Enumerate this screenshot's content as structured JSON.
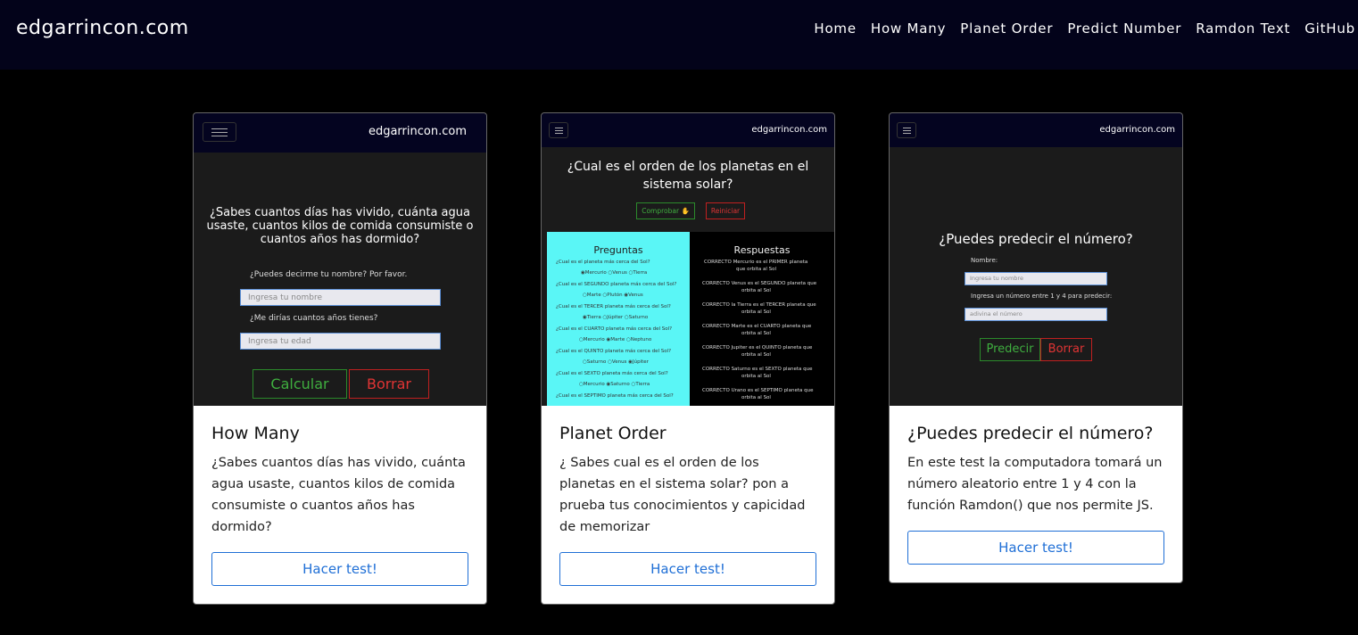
{
  "nav": {
    "brand": "edgarrincon.com",
    "links": [
      "Home",
      "How Many",
      "Planet Order",
      "Predict Number",
      "Ramdon Text",
      "GitHub"
    ]
  },
  "cards": [
    {
      "title": "How Many",
      "text": "¿Sabes cuantos días has vivido, cuánta agua usaste, cuantos kilos de comida consumiste o cuantos años has dormido?",
      "button": "Hacer test!",
      "preview": {
        "brand": "edgarrincon.com",
        "heading": "¿Sabes cuantos días has vivido, cuánta agua usaste, cuantos kilos de comida consumiste o cuantos años has dormido?",
        "q1": "¿Puedes decirme tu nombre? Por favor.",
        "p1": "Ingresa tu nombre",
        "q2": "¿Me dirías cuantos años tienes?",
        "p2": "Ingresa tu edad",
        "btn_calc": "Calcular",
        "btn_clear": "Borrar"
      }
    },
    {
      "title": "Planet Order",
      "text": "¿ Sabes cual es el orden de los planetas en el sistema solar? pon a prueba tus conocimientos y capicidad de memorizar",
      "button": "Hacer test!",
      "preview": {
        "brand": "edgarrincon.com",
        "heading": "¿Cual es el orden de los planetas en el sistema solar?",
        "btn_check": "Comprobar ✋",
        "btn_reset": "Reiniciar",
        "col_q": "Preguntas",
        "col_a": "Respuestas"
      }
    },
    {
      "title": "¿Puedes predecir el número?",
      "text": "En este test la computadora tomará un número aleatorio entre 1 y 4 con la función Ramdon() que nos permite JS.",
      "button": "Hacer test!",
      "preview": {
        "brand": "edgarrincon.com",
        "heading": "¿Puedes predecir el número?",
        "l1": "Nombre:",
        "p1": "Ingresa tu nombre",
        "l2": "Ingresa un número entre 1 y 4 para predecir:",
        "p2": "adivina el número",
        "btn_predict": "Predecir",
        "btn_clear": "Borrar"
      }
    }
  ]
}
